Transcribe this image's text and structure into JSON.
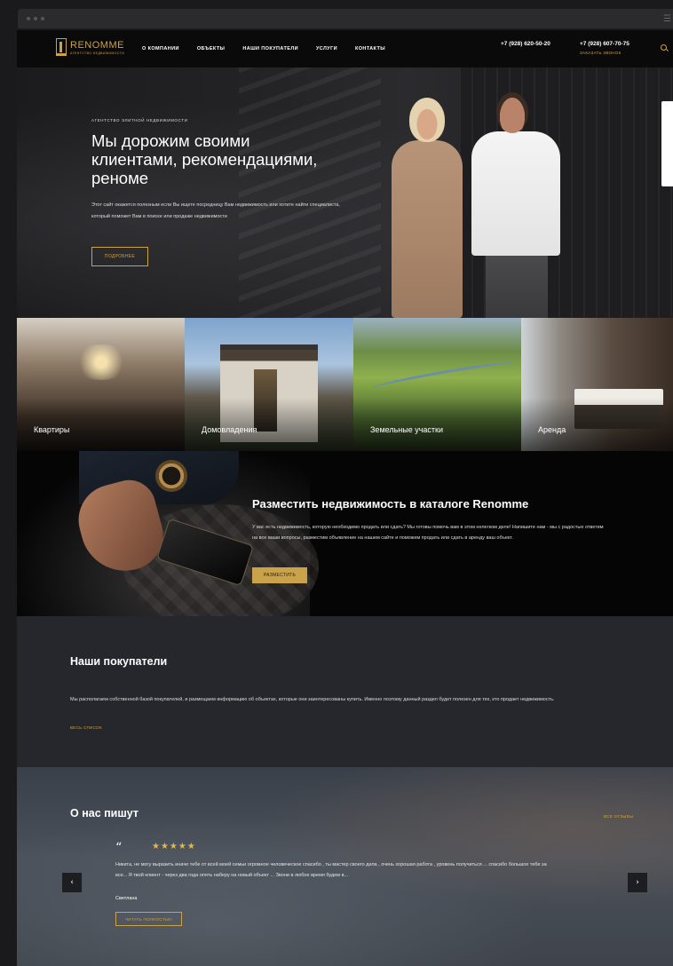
{
  "header": {
    "logo_name": "RENOMME",
    "logo_sub": "АГЕНТСТВО НЕДВИЖИМОСТИ",
    "nav": [
      "О компании",
      "Объекты",
      "Наши покупатели",
      "Услуги",
      "Контакты"
    ],
    "phone_1": "+7 (928) 620-50-20",
    "phone_2": "+7 (928) 607-70-75",
    "callback": "Заказать звонок"
  },
  "hero": {
    "kicker": "Агентство элитной недвижимости",
    "title": "Мы дорожим своими клиентами, рекомендациями, реноме",
    "text": "Этот сайт окажется полезным если Вы ищете посредницу Вам недвижимость или хотите найти специалиста, который поможет Вам в поиске или продаже недвижимости",
    "button": "Подробнее"
  },
  "categories": [
    "Квартиры",
    "Домовладения",
    "Земельные участки",
    "Аренда"
  ],
  "place": {
    "title": "Разместить недвижимость в каталоге Renomme",
    "text": "У вас есть недвижимость, которую необходимо продать или сдать? Мы готовы помочь вам в этом нелегком деле! Напишите нам - мы с радостью ответим на все ваши вопросы, разместим объявление на нашем сайте и поможем продать или сдать в аренду ваш объект.",
    "button": "Разместить"
  },
  "buyers": {
    "title": "Наши покупатели",
    "text": "Мы располагаем собственной базой покупателей, и размещаем информацию об объектах, которые они заинтересованы купить. Именно поэтому данный раздел будет полезен для тех, кто продает недвижимость.",
    "link": "Весь список"
  },
  "reviews": {
    "title": "О нас пишут",
    "all_link": "Все отзывы",
    "quote": "“",
    "stars": "★★★★★",
    "rating": 5,
    "text": "Никита, не могу выразить иначе тебе от всей моей семьи огромное человеческое спасибо , ты мастер своего дела , очень хорошая работа , уровень получиться ... спасибо большое тебе за все... Я твой клиент - через два года опять наберу на новый объект ... Звони в любое время будем в...",
    "author": "Светлана",
    "button": "Читать полностью",
    "prev": "‹",
    "next": "›"
  },
  "colors": {
    "accent": "#c9a24a",
    "background": "#0d0d0e",
    "buyers_bg": "#25272c"
  }
}
